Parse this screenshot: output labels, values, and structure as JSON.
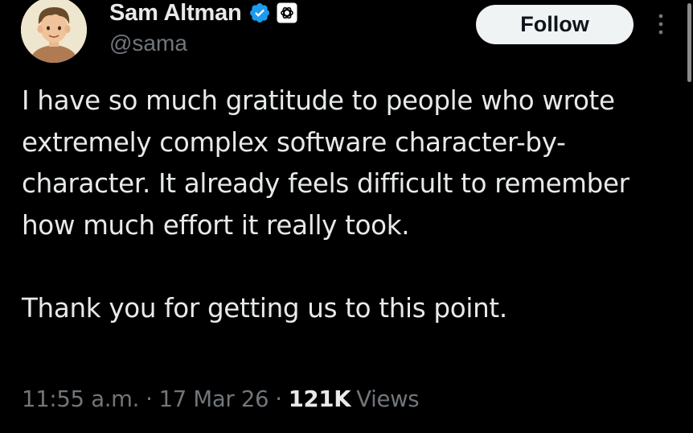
{
  "author": {
    "display_name": "Sam Altman",
    "handle": "@sama",
    "verified": true,
    "affiliate_badge": "openai-logo-icon",
    "avatar": "cartoon-portrait-avatar"
  },
  "actions": {
    "follow_label": "Follow",
    "more_icon": "more-vertical-icon"
  },
  "tweet": {
    "paragraphs": [
      "I have so much gratitude to people who wrote extremely complex software character-by-character. It already feels difficult to remember how much effort it really took.",
      "Thank you for getting us to this point."
    ],
    "time": "11:55 a.m.",
    "date": "17 Mar 26",
    "separator": "·",
    "views_count": "121K",
    "views_label": "Views"
  },
  "colors": {
    "background": "#000000",
    "primary_text": "#e7e9ea",
    "secondary_text": "#71767b",
    "verified_blue": "#1d9bf0",
    "follow_bg": "#eff3f4"
  }
}
